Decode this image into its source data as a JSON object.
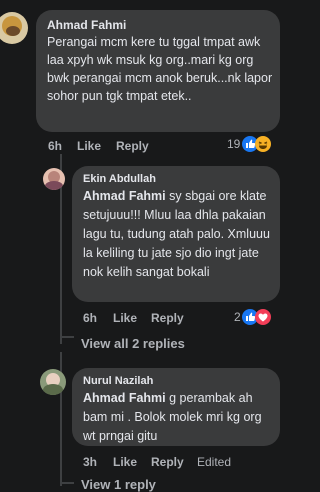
{
  "comments": [
    {
      "author": "Ahmad Fahmi",
      "text": "Perangai mcm kere tu tggal tmpat awk laa xpyh wk msuk kg org..mari kg org bwk perangai mcm anok beruk...nk lapor sohor pun tgk tmpat etek..",
      "time": "6h",
      "like": "Like",
      "reply": "Reply",
      "reaction_count": "19",
      "reactions": [
        "like-icon",
        "laughing-icon"
      ]
    },
    {
      "author": "Ekin Abdullah",
      "mention": "Ahmad Fahmi",
      "text": " sy sbgai ore klate setujuuu!!! Mluu laa dhla pakaian lagu tu, tudung atah palo. Xmluuu la keliling tu jate sjo dio ingt jate nok kelih sangat bokali",
      "time": "6h",
      "like": "Like",
      "reply": "Reply",
      "reaction_count": "2",
      "reactions": [
        "like-icon",
        "heart-icon"
      ]
    },
    {
      "author": "Nurul Nazilah",
      "mention": "Ahmad Fahmi",
      "text": " g perambak ah bam mi . Bolok molek mri kg org wt prngai gitu",
      "time": "3h",
      "like": "Like",
      "reply": "Reply",
      "edited": "Edited"
    }
  ],
  "view_replies_1": "View all 2 replies",
  "view_replies_2": "View 1 reply",
  "colors": {
    "background": "#18191a",
    "bubble": "#3a3b3c",
    "muted": "#b0b3b8",
    "like_blue": "#1877f2",
    "heart_red": "#f33e58",
    "laugh_yellow": "#f7b125"
  }
}
